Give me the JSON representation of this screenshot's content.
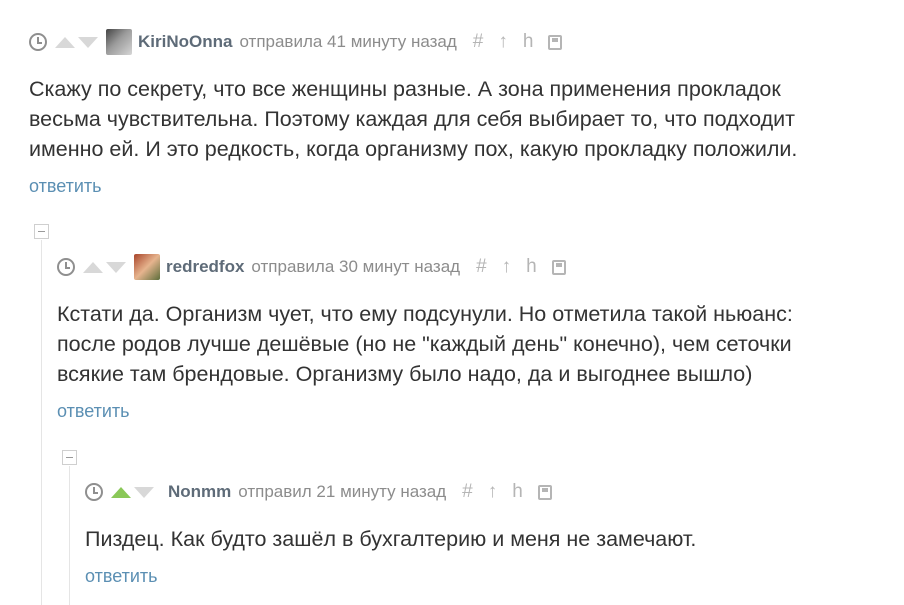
{
  "comments": [
    {
      "username": "KiriNoOnna",
      "meta": "отправила 41 минуту назад",
      "text": "Скажу по секрету, что все женщины разные. А зона применения прокладок\nвесьма чувствительна. Поэтому каждая для себя выбирает то, что подходит\nименно ей. И это редкость, когда организму пох, какую прокладку положили.",
      "reply_label": "ответить",
      "avatar_icon": "user-avatar-bw",
      "vote": "none"
    },
    {
      "username": "redredfox",
      "meta": "отправила 30 минут назад",
      "text": "Кстати да. Организм чует, что ему подсунули. Но отметила такой ньюанс:\nпосле родов лучше дешёвые (но не \"каждый день\" конечно), чем сеточки\nвсякие там брендовые. Организму было надо, да и выгоднее вышло)",
      "reply_label": "ответить",
      "avatar_icon": "user-avatar-fox",
      "vote": "none"
    },
    {
      "username": "Nonmm",
      "meta": "отправил 21 минуту назад",
      "text": "Пиздец. Как будто зашёл в бухгалтерию и меня не замечают.",
      "reply_label": "ответить",
      "vote": "up"
    }
  ],
  "icons": {
    "hash": "#",
    "arrow_up": "↑",
    "branch": "h"
  },
  "colors": {
    "username": "#5e6b78",
    "reply_link": "#5b8fb3",
    "upvote_active": "#8ac858",
    "vote_inactive": "#d8d8d8",
    "text": "#333333"
  }
}
